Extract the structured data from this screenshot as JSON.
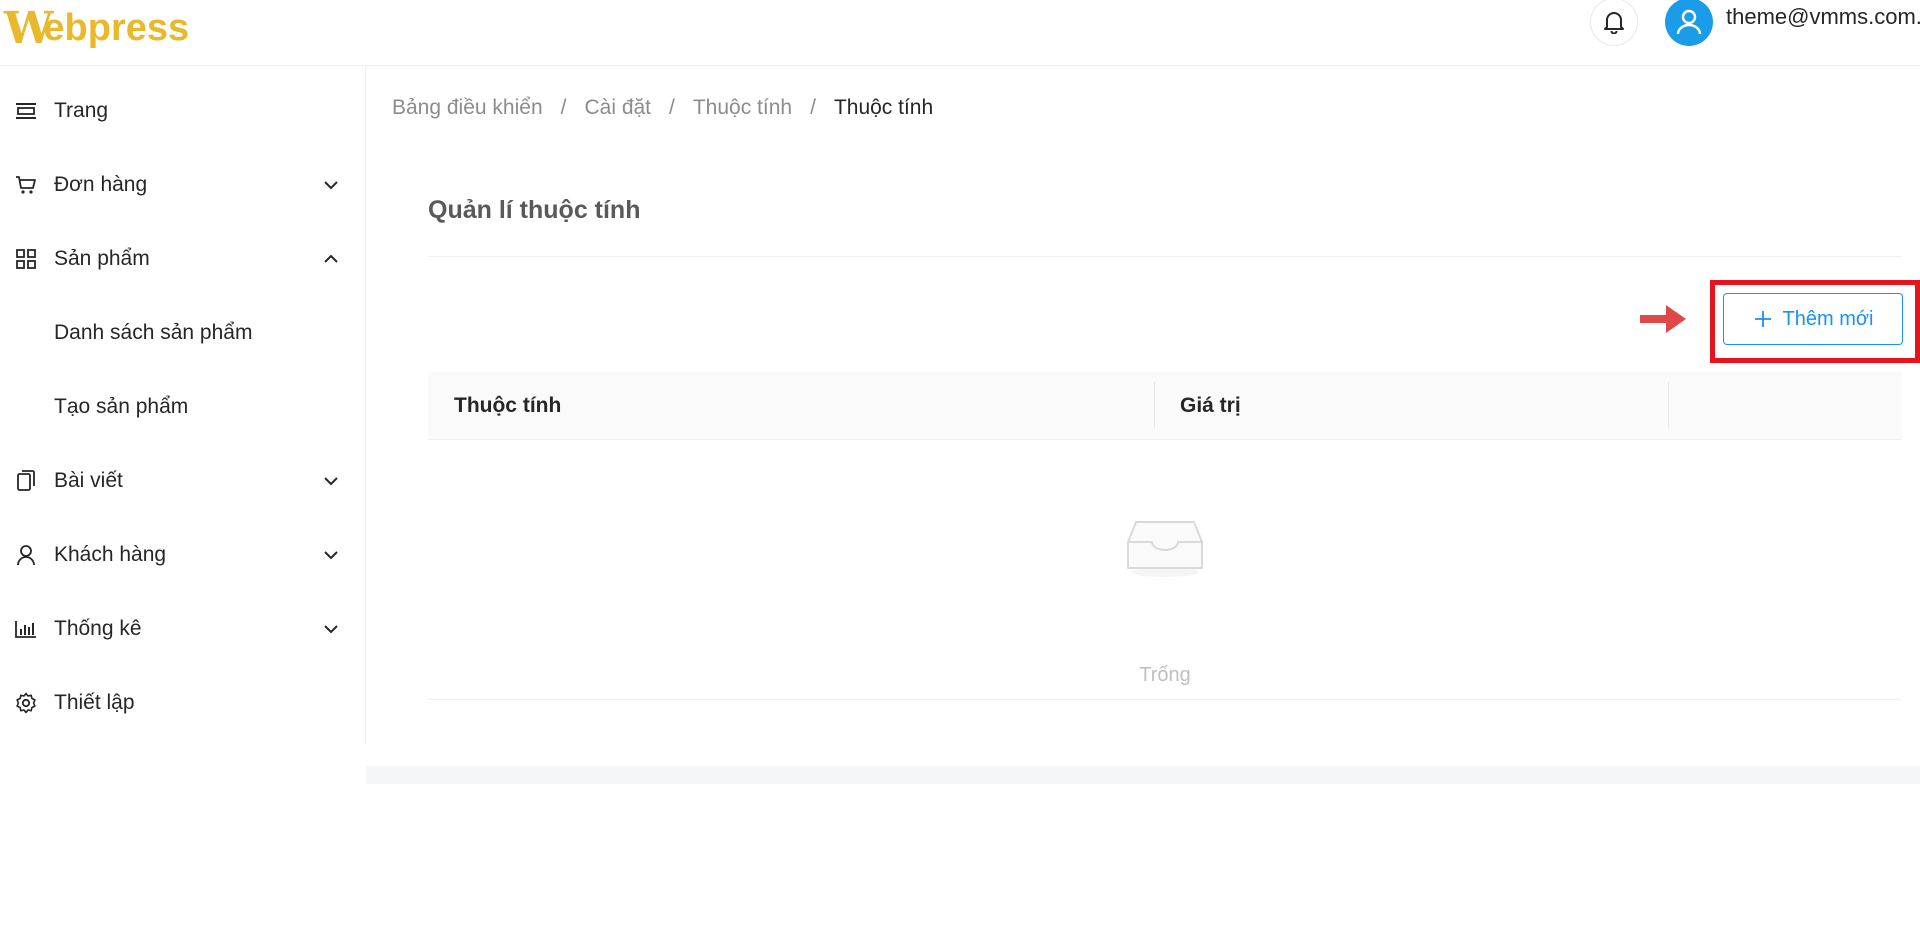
{
  "header": {
    "logo_mark": "W",
    "logo_text": "ebpress",
    "user_email": "theme@vmms.com.vn"
  },
  "sidebar": {
    "items": [
      {
        "label": "Trang",
        "icon": "layout-icon"
      },
      {
        "label": "Đơn hàng",
        "icon": "cart-icon",
        "arrow": "down"
      },
      {
        "label": "Sản phẩm",
        "icon": "grid-icon",
        "arrow": "up"
      },
      {
        "label": "Danh sách sản phẩm"
      },
      {
        "label": "Tạo sản phẩm"
      },
      {
        "label": "Bài viết",
        "icon": "copy-icon",
        "arrow": "down"
      },
      {
        "label": "Khách hàng",
        "icon": "user-icon",
        "arrow": "down"
      },
      {
        "label": "Thống kê",
        "icon": "bar-chart-icon",
        "arrow": "down"
      },
      {
        "label": "Thiết lập",
        "icon": "gear-icon"
      }
    ]
  },
  "breadcrumb": {
    "items": [
      "Bảng điều khiển",
      "Cài đặt",
      "Thuộc tính",
      "Thuộc tính"
    ],
    "separator": "/"
  },
  "main": {
    "title": "Quản lí thuộc tính",
    "add_button": "Thêm mới",
    "table": {
      "columns": [
        "Thuộc tính",
        "Giá trị"
      ],
      "empty_text": "Trống"
    }
  },
  "colors": {
    "brand": "#e8b92c",
    "primary": "#1890ff",
    "highlight": "#e5141d",
    "avatar": "#1a9ce8"
  }
}
